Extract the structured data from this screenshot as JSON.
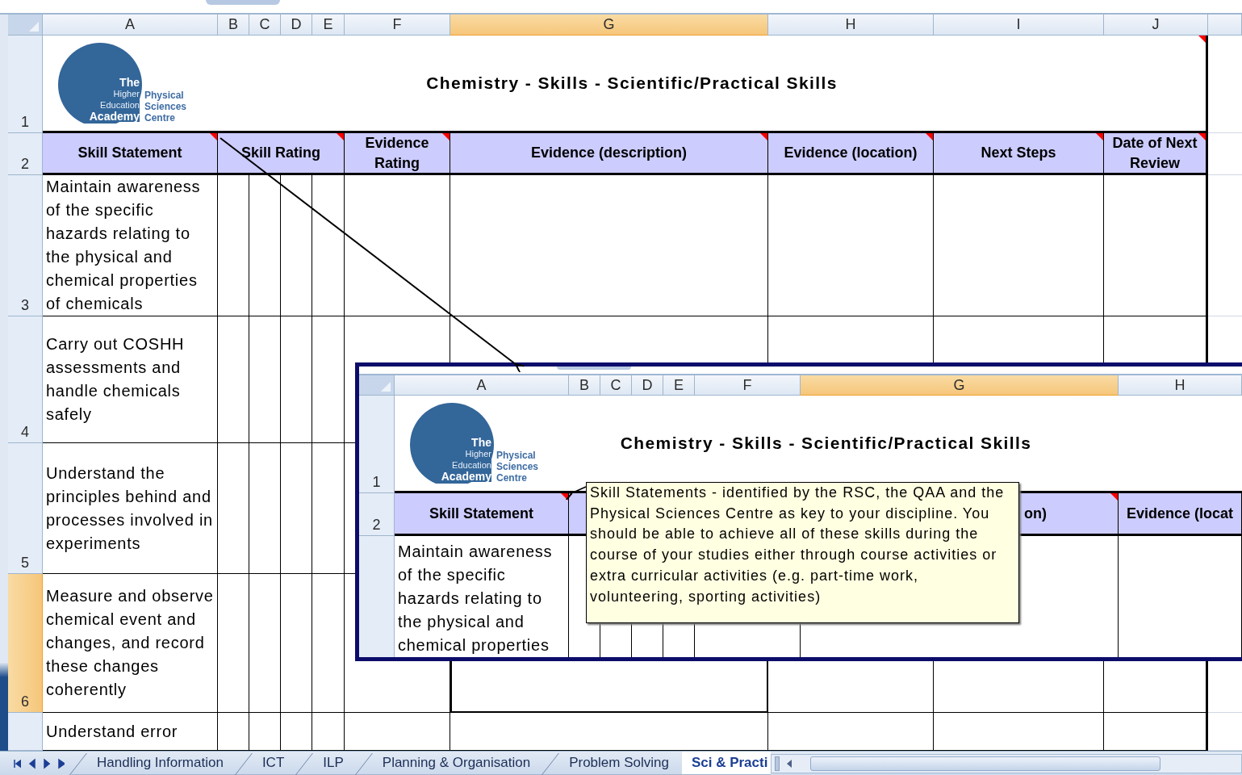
{
  "sheet": {
    "columns": [
      {
        "label": "A",
        "selected": false
      },
      {
        "label": "B",
        "selected": false
      },
      {
        "label": "C",
        "selected": false
      },
      {
        "label": "D",
        "selected": false
      },
      {
        "label": "E",
        "selected": false
      },
      {
        "label": "F",
        "selected": false
      },
      {
        "label": "G",
        "selected": true
      },
      {
        "label": "H",
        "selected": false
      },
      {
        "label": "I",
        "selected": false
      },
      {
        "label": "J",
        "selected": false
      }
    ],
    "row_headers": [
      {
        "label": "1",
        "selected": false
      },
      {
        "label": "2",
        "selected": false
      },
      {
        "label": "3",
        "selected": false
      },
      {
        "label": "4",
        "selected": false
      },
      {
        "label": "5",
        "selected": false
      },
      {
        "label": "6",
        "selected": true
      },
      {
        "selected": false
      }
    ],
    "logo": {
      "left_lines": [
        "The",
        "Higher",
        "Education",
        "Academy"
      ],
      "right_lines": [
        "Physical",
        "Sciences",
        "Centre"
      ]
    },
    "title": {
      "text": "Chemistry - Skills - Scientific/Practical Skills",
      "has_comment": true
    },
    "headers": [
      {
        "text": "Skill Statement",
        "has_comment": true
      },
      {
        "text": "Skill Rating",
        "has_comment": true
      },
      {
        "text": "Evidence Rating",
        "has_comment": true
      },
      {
        "text": "Evidence (description)",
        "has_comment": true
      },
      {
        "text": "Evidence (location)",
        "has_comment": true
      },
      {
        "text": "Next Steps",
        "has_comment": true
      },
      {
        "text": "Date of Next Review",
        "has_comment": true
      }
    ],
    "rows": [
      {
        "statement": "Maintain awareness of the specific hazards relating to the physical and chemical properties of chemicals"
      },
      {
        "statement": "Carry out COSHH assessments and handle chemicals safely"
      },
      {
        "statement": "Understand the principles behind and processes involved in experiments"
      },
      {
        "statement": "Measure and observe chemical event and changes, and record these changes coherently"
      },
      {
        "statement": "Understand error"
      }
    ]
  },
  "inset": {
    "columns": [
      {
        "label": "A",
        "selected": false
      },
      {
        "label": "B",
        "selected": false
      },
      {
        "label": "C",
        "selected": false
      },
      {
        "label": "D",
        "selected": false
      },
      {
        "label": "E",
        "selected": false
      },
      {
        "label": "F",
        "selected": false
      },
      {
        "label": "G",
        "selected": true
      },
      {
        "label": "H",
        "selected": false
      }
    ],
    "row_headers": [
      {
        "label": "1",
        "selected": false
      },
      {
        "label": "2",
        "selected": false
      },
      {
        "selected": false
      }
    ],
    "logo": {
      "left_lines": [
        "The",
        "Higher",
        "Education",
        "Academy"
      ],
      "right_lines": [
        "Physical",
        "Sciences",
        "Centre"
      ]
    },
    "title": {
      "text": "Chemistry - Skills - Scientific/Practical Skills"
    },
    "headers": [
      {
        "text": "Skill Statement",
        "has_comment": true
      },
      {
        "kind": "blank"
      },
      {
        "kind": "blank"
      },
      {
        "text": "on)",
        "has_comment": true,
        "kind": "clipped_left"
      },
      {
        "text": "Evidence (locat",
        "kind": "clipped_right"
      }
    ],
    "rows": [
      {
        "statement": "Maintain awareness of the specific hazards relating to the physical and chemical properties"
      }
    ]
  },
  "comment": {
    "text": "Skill Statements - identified by the RSC, the QAA and the Physical Sciences Centre as key to your discipline. You should be able to achieve all of these skills during the course of your studies either through course activities or extra curricular activities (e.g. part-time work, volunteering, sporting activities)"
  },
  "sheet_tabs": [
    {
      "label": "Handling Information",
      "selected": false
    },
    {
      "label": "ICT",
      "selected": false
    },
    {
      "label": "ILP",
      "selected": false
    },
    {
      "label": "Planning & Organisation",
      "selected": false
    },
    {
      "label": "Problem Solving",
      "selected": false
    },
    {
      "label": "Sci & Practi",
      "selected": true
    }
  ]
}
